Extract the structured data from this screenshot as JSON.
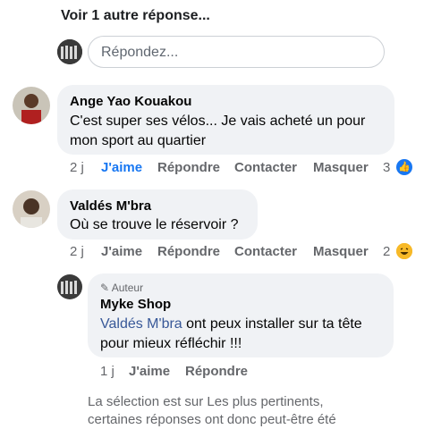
{
  "more_replies_label": "Voir 1 autre réponse...",
  "reply_input": {
    "placeholder": "Répondez..."
  },
  "comments": [
    {
      "author": "Ange Yao Kouakou",
      "text_line1": "C'est super ses vélos... Je vais acheté un pour",
      "text_line2": "mon sport au quartier",
      "time": "2 j",
      "like": "J'aime",
      "reply": "Répondre",
      "contact": "Contacter",
      "hide": "Masquer",
      "reactions": "3"
    },
    {
      "author": "Valdés M'bra",
      "text_line1": "Où se trouve le réservoir ?",
      "time": "2 j",
      "like": "J'aime",
      "reply": "Répondre",
      "contact": "Contacter",
      "hide": "Masquer",
      "reactions": "2"
    }
  ],
  "nested_reply": {
    "badge": "Auteur",
    "author": "Myke Shop",
    "mention": "Valdés M'bra",
    "text_line1_rest": " ont peux installer sur ta tête",
    "text_line2": "pour mieux réfléchir !!!",
    "time": "1 j",
    "like": "J'aime",
    "reply": "Répondre"
  },
  "footer_note": {
    "line1": "La sélection est sur Les plus pertinents,",
    "line2": "certaines réponses ont donc peut-être été"
  },
  "colors": {
    "link_blue": "#1877f2",
    "bubble": "#f0f2f5",
    "mention": "#385898"
  }
}
